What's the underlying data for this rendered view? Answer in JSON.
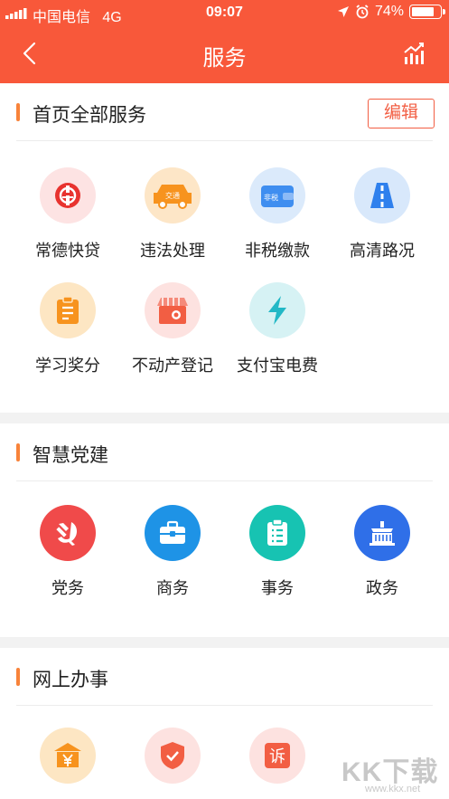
{
  "status_bar": {
    "carrier": "中国电信",
    "network": "4G",
    "time": "09:07",
    "battery": "74%"
  },
  "nav": {
    "title": "服务"
  },
  "sections": {
    "home": {
      "title": "首页全部服务",
      "edit_label": "编辑",
      "items": [
        {
          "label": "常德快贷",
          "icon": "bank-icon"
        },
        {
          "label": "违法处理",
          "icon": "traffic-car-icon",
          "icon_text": "交通"
        },
        {
          "label": "非税缴款",
          "icon": "wallet-icon",
          "icon_text": "非税"
        },
        {
          "label": "高清路况",
          "icon": "road-icon"
        },
        {
          "label": "学习奖分",
          "icon": "study-icon"
        },
        {
          "label": "不动产登记",
          "icon": "shop-icon"
        },
        {
          "label": "支付宝电费",
          "icon": "lightning-icon"
        }
      ]
    },
    "party": {
      "title": "智慧党建",
      "items": [
        {
          "label": "党务",
          "icon": "party-emblem-icon"
        },
        {
          "label": "商务",
          "icon": "briefcase-icon"
        },
        {
          "label": "事务",
          "icon": "clipboard-icon"
        },
        {
          "label": "政务",
          "icon": "government-building-icon"
        }
      ]
    },
    "online": {
      "title": "网上办事",
      "items": [
        {
          "label": "",
          "icon": "yuan-building-icon"
        },
        {
          "label": "",
          "icon": "shield-check-icon"
        },
        {
          "label": "",
          "icon": "complaint-icon",
          "icon_text": "诉"
        }
      ]
    }
  },
  "watermark": {
    "big": "KK下载",
    "small": "www.kkx.net"
  },
  "colors": {
    "header": "#f8583a",
    "accent": "#f8833a",
    "edit": "#f25e43"
  }
}
